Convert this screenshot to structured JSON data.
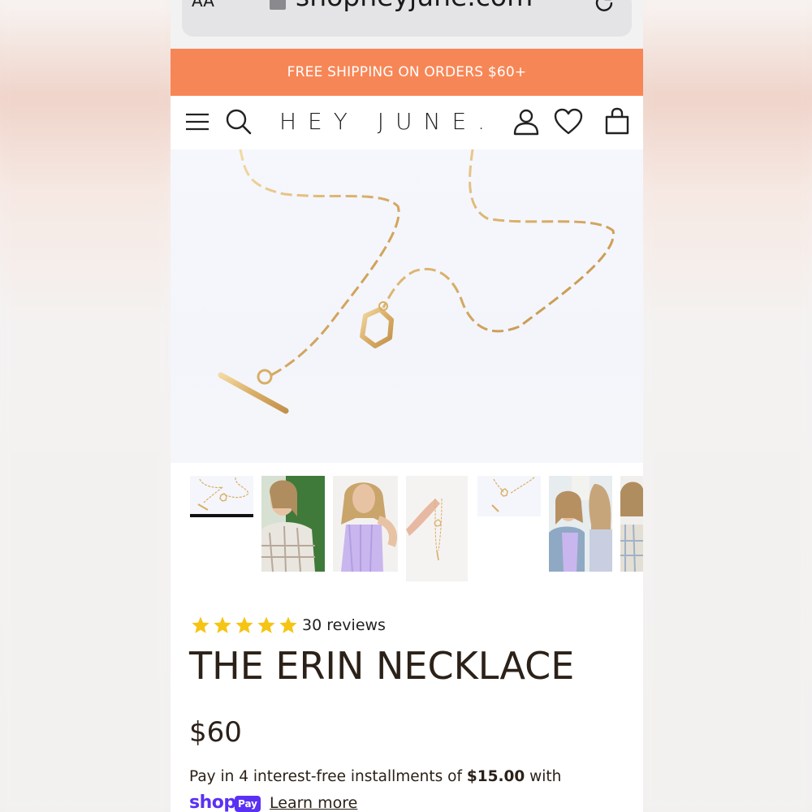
{
  "browser": {
    "text_size_label": "AA",
    "url": "shopheyjune.com"
  },
  "promo_banner": {
    "text": "FREE SHIPPING ON ORDERS $60+",
    "background": "#f78656"
  },
  "header": {
    "logo": "HEY JUNE.",
    "icons": [
      "menu-icon",
      "search-icon",
      "account-icon",
      "heart-icon",
      "cart-icon"
    ]
  },
  "hero": {
    "image_label": "product-photo"
  },
  "gallery": {
    "thumbnails": [
      {
        "name": "thumb-1",
        "selected": true
      },
      {
        "name": "thumb-2",
        "selected": false
      },
      {
        "name": "thumb-3",
        "selected": false
      },
      {
        "name": "thumb-4",
        "selected": false
      },
      {
        "name": "thumb-5",
        "selected": false
      },
      {
        "name": "thumb-6",
        "selected": false
      },
      {
        "name": "thumb-7",
        "selected": false
      }
    ]
  },
  "product": {
    "rating_stars": 5,
    "star_color": "#f6c413",
    "reviews": "30 reviews",
    "title": "THE ERIN NECKLACE",
    "price": "$60",
    "installments_prefix": "Pay in 4 interest-free installments of ",
    "installments_amount": "$15.00",
    "installments_suffix": " with",
    "shop_pay_word": "shop",
    "shop_pay_badge": "Pay",
    "shop_pay_color": "#5a31f4",
    "learn_more": "Learn more"
  }
}
